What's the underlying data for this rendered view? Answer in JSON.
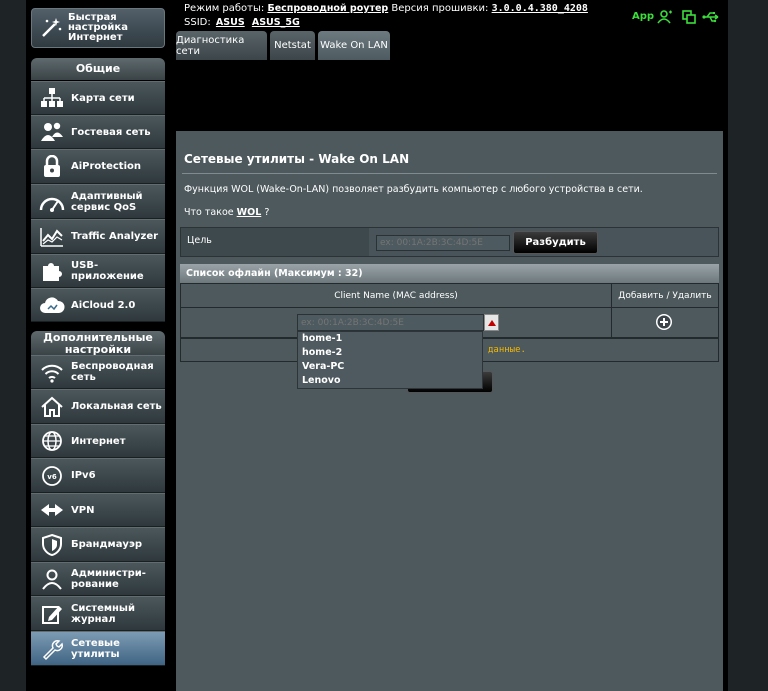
{
  "quick_setup": {
    "label": "Быстрая\nнастройка\nИнтернет"
  },
  "sidebar": {
    "general_header": "Общие",
    "general_items": [
      {
        "label": "Карта сети"
      },
      {
        "label": "Гостевая сеть"
      },
      {
        "label": "AiProtection"
      },
      {
        "label": "Адаптивный\nсервис QoS"
      },
      {
        "label": "Traffic Analyzer"
      },
      {
        "label": "USB-\nприложение"
      },
      {
        "label": "AiCloud 2.0"
      }
    ],
    "advanced_header": "Дополнительные\nнастройки",
    "advanced_items": [
      {
        "label": "Беспроводная\nсеть"
      },
      {
        "label": "Локальная сеть"
      },
      {
        "label": "Интернет"
      },
      {
        "label": "IPv6"
      },
      {
        "label": "VPN"
      },
      {
        "label": "Брандмауэр"
      },
      {
        "label": "Администри-\nрование"
      },
      {
        "label": "Системный\nжурнал"
      },
      {
        "label": "Сетевые\nутилиты"
      }
    ]
  },
  "header": {
    "mode_label": "Режим работы:",
    "mode_value": "Беспроводной роутер",
    "firmware_label": "Версия прошивки:",
    "firmware_value": "3.0.0.4.380_4208",
    "ssid_label": "SSID:",
    "ssid_1": "ASUS",
    "ssid_2": "ASUS_5G",
    "app_label": "App"
  },
  "tabs": [
    {
      "label": "Диагностика сети"
    },
    {
      "label": "Netstat"
    },
    {
      "label": "Wake On LAN"
    }
  ],
  "main": {
    "title": "Сетевые утилиты - Wake On LAN",
    "description": "Функция WOL (Wake-On-LAN) позволяет разбудить компьютер с любого устройства в сети.",
    "what_is_prefix": "Что такое",
    "what_is_link": "WOL",
    "what_is_suffix": "?",
    "target_label": "Цель",
    "target_placeholder": "ex: 00:1A:2B:3C:4D:5E",
    "wake_button": "Разбудить",
    "offline_list_title": "Список офлайн (Максимум : 32)",
    "col_client": "Client Name (MAC address)",
    "col_action": "Добавить / Удалить",
    "combo_placeholder": "ex: 00:1A:2B:3C:4D:5E",
    "no_data_tail": "данные.",
    "dropdown_options": [
      "home-1",
      "home-2",
      "Vera-PC",
      "Lenovo"
    ]
  },
  "colors": {
    "header_green": "#3cde3c",
    "no_data_text": "#f2b705",
    "active_sidebar": "#5f82a2"
  }
}
